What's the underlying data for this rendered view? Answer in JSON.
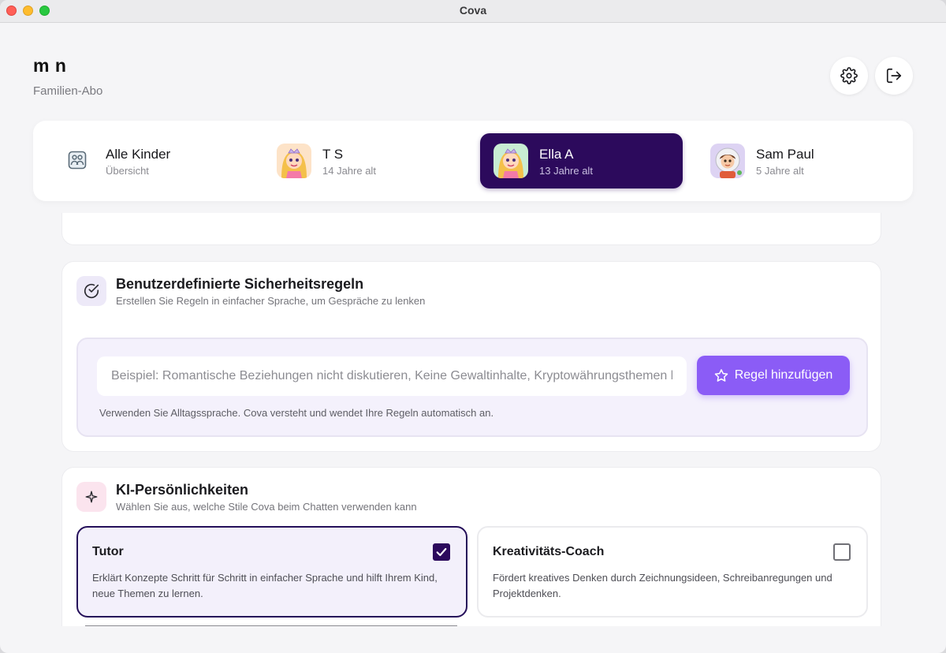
{
  "window": {
    "title": "Cova"
  },
  "header": {
    "user_name": "m n",
    "plan": "Familien-Abo",
    "settings_icon": "gear-icon",
    "logout_icon": "logout-icon"
  },
  "kids": [
    {
      "name": "Alle Kinder",
      "subtitle": "Übersicht",
      "active": false,
      "icon": "family-icon"
    },
    {
      "name": "T S",
      "subtitle": "14 Jahre alt",
      "active": false,
      "icon": "princess-avatar"
    },
    {
      "name": "Ella A",
      "subtitle": "13 Jahre alt",
      "active": true,
      "icon": "princess-avatar"
    },
    {
      "name": "Sam Paul",
      "subtitle": "5 Jahre alt",
      "active": false,
      "icon": "astronaut-avatar"
    }
  ],
  "safety_rules": {
    "title": "Benutzerdefinierte Sicherheitsregeln",
    "subtitle": "Erstellen Sie Regeln in einfacher Sprache, um Gespräche zu lenken",
    "icon": "check-circle-icon",
    "input_value": "",
    "input_placeholder": "Beispiel: Romantische Beziehungen nicht diskutieren, Keine Gewaltinhalte, Kryptowährungsthemen bl",
    "add_button_label": "Regel hinzufügen",
    "add_button_icon": "star-icon",
    "hint": "Verwenden Sie Alltagssprache. Cova versteht und wendet Ihre Regeln automatisch an."
  },
  "personalities": {
    "title": "KI-Persönlichkeiten",
    "subtitle": "Wählen Sie aus, welche Stile Cova beim Chatten verwenden kann",
    "icon": "sparkle-icon",
    "items": [
      {
        "title": "Tutor",
        "description": "Erklärt Konzepte Schritt für Schritt in einfacher Sprache und hilft Ihrem Kind, neue Themen zu lernen.",
        "checked": true
      },
      {
        "title": "Kreativitäts-Coach",
        "description": "Fördert kreatives Denken durch Zeichnungsideen, Schreibanregungen und Projektdenken.",
        "checked": false
      }
    ]
  },
  "colors": {
    "accent": "#8b5cf6",
    "active_tab": "#2c0a5c",
    "background": "#f5f5f7"
  }
}
